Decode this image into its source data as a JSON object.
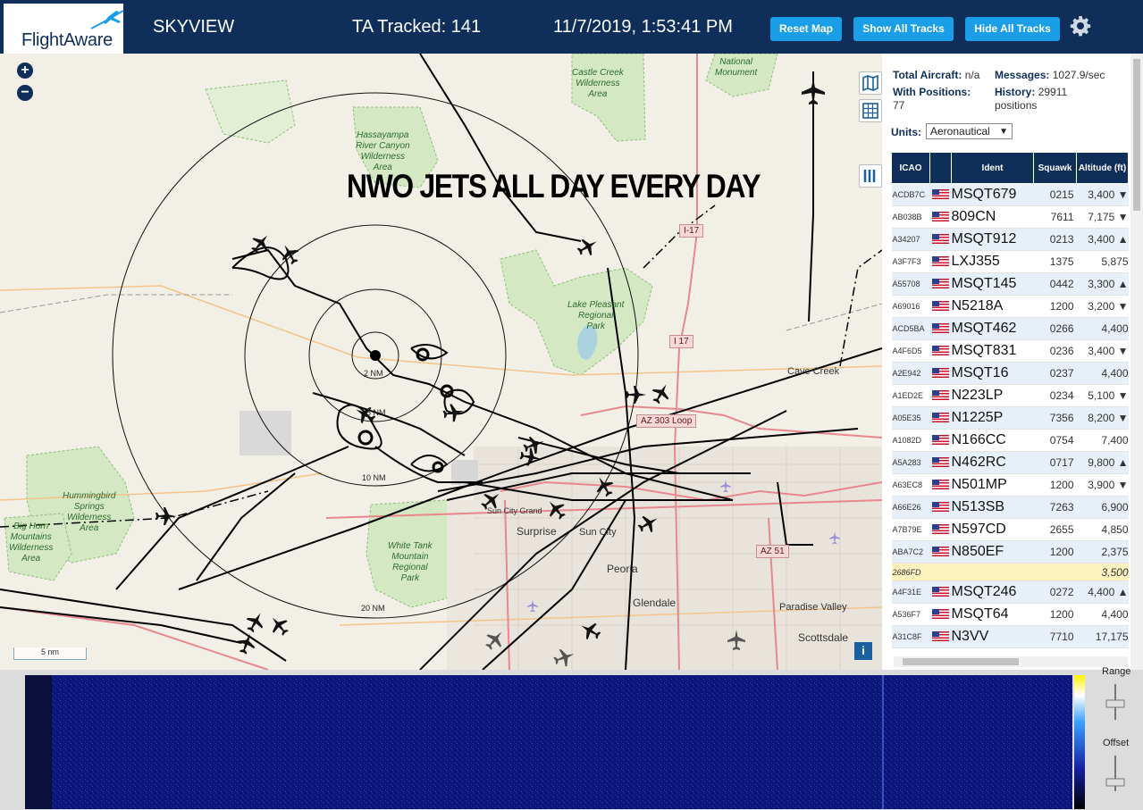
{
  "header": {
    "logo": "FlightAware",
    "app_name": "SKYVIEW",
    "tracked_label": "TA Tracked: 141",
    "datetime": "11/7/2019, 1:53:41 PM",
    "buttons": {
      "reset": "Reset Map",
      "show": "Show All Tracks",
      "hide": "Hide All Tracks"
    },
    "settings_icon": "gear-icon"
  },
  "map": {
    "banner": "NWO JETS ALL DAY EVERY DAY",
    "zoom_in": "+",
    "zoom_out": "−",
    "scale": "5 nm",
    "info": "i",
    "range_labels": [
      "2 NM",
      "5 NM",
      "10 NM",
      "20 NM"
    ],
    "areas": [
      "National\nMonument",
      "Castle Creek\nWilderness\nArea",
      "Hassayampa\nRiver Canyon\nWilderness\nArea",
      "Lake Pleasant\nRegional\nPark",
      "Hummingbird\nSprings\nWilderness\nArea",
      "Big Horn\nMountains\nWilderness\nArea",
      "White Tank\nMountain\nRegional\nPark"
    ],
    "cities": [
      "Cave Creek",
      "Sun City",
      "Paradise Valley",
      "Sun City Grand"
    ],
    "big_cities": [
      "Surprise",
      "Peoria",
      "Glendale",
      "Scottsdale"
    ],
    "roads": [
      "I-17",
      "I 17",
      "AZ 303 Loop",
      "AZ 51"
    ]
  },
  "panel": {
    "stats": {
      "total_label": "Total Aircraft:",
      "total_value": "n/a",
      "messages_label": "Messages:",
      "messages_value": "1027.9/sec",
      "positions_label": "With Positions:",
      "positions_value": "77",
      "history_label": "History:",
      "history_value": "29911 positions"
    },
    "units_label": "Units:",
    "units_value": "Aeronautical",
    "columns": [
      "ICAO",
      "",
      "Ident",
      "Squawk",
      "Altitude (ft)"
    ],
    "rows": [
      {
        "icao": "ACDB7C",
        "ident": "MSQT679",
        "squawk": "0215",
        "alt": "3,400 ▼"
      },
      {
        "icao": "AB038B",
        "ident": "809CN",
        "squawk": "7611",
        "alt": "7,175 ▼"
      },
      {
        "icao": "A34207",
        "ident": "MSQT912",
        "squawk": "0213",
        "alt": "3,400 ▲"
      },
      {
        "icao": "A3F7F3",
        "ident": "LXJ355",
        "squawk": "1375",
        "alt": "5,875"
      },
      {
        "icao": "A55708",
        "ident": "MSQT145",
        "squawk": "0442",
        "alt": "3,300 ▲"
      },
      {
        "icao": "A69016",
        "ident": "N5218A",
        "squawk": "1200",
        "alt": "3,200 ▼"
      },
      {
        "icao": "ACD5BA",
        "ident": "MSQT462",
        "squawk": "0266",
        "alt": "4,400"
      },
      {
        "icao": "A4F6D5",
        "ident": "MSQT831",
        "squawk": "0236",
        "alt": "3,400 ▼"
      },
      {
        "icao": "A2E942",
        "ident": "MSQT16",
        "squawk": "0237",
        "alt": "4,400"
      },
      {
        "icao": "A1ED2E",
        "ident": "N223LP",
        "squawk": "0234",
        "alt": "5,100 ▼"
      },
      {
        "icao": "A05E35",
        "ident": "N1225P",
        "squawk": "7356",
        "alt": "8,200 ▼"
      },
      {
        "icao": "A1082D",
        "ident": "N166CC",
        "squawk": "0754",
        "alt": "7,400"
      },
      {
        "icao": "A5A283",
        "ident": "N462RC",
        "squawk": "0717",
        "alt": "9,800 ▲"
      },
      {
        "icao": "A63EC8",
        "ident": "N501MP",
        "squawk": "1200",
        "alt": "3,900 ▼"
      },
      {
        "icao": "A66E26",
        "ident": "N513SB",
        "squawk": "7263",
        "alt": "6,900"
      },
      {
        "icao": "A7B79E",
        "ident": "N597CD",
        "squawk": "2655",
        "alt": "4,850"
      },
      {
        "icao": "ABA7C2",
        "ident": "N850EF",
        "squawk": "1200",
        "alt": "2,375"
      },
      {
        "icao": "2686FD",
        "ident": "",
        "squawk": "",
        "alt": "3,500",
        "highlight": true
      },
      {
        "icao": "A4F31E",
        "ident": "MSQT246",
        "squawk": "0272",
        "alt": "4,400 ▲"
      },
      {
        "icao": "A536F7",
        "ident": "MSQT64",
        "squawk": "1200",
        "alt": "4,400"
      },
      {
        "icao": "A31C8F",
        "ident": "N3VV",
        "squawk": "7710",
        "alt": "17,175"
      }
    ]
  },
  "waterfall": {
    "range_label": "Range",
    "offset_label": "Offset"
  },
  "colors": {
    "header": "#0f2f5a",
    "button": "#1a9ee8",
    "row_alt": "#e7f0f8",
    "highlight_row": "#fdf1bd"
  }
}
